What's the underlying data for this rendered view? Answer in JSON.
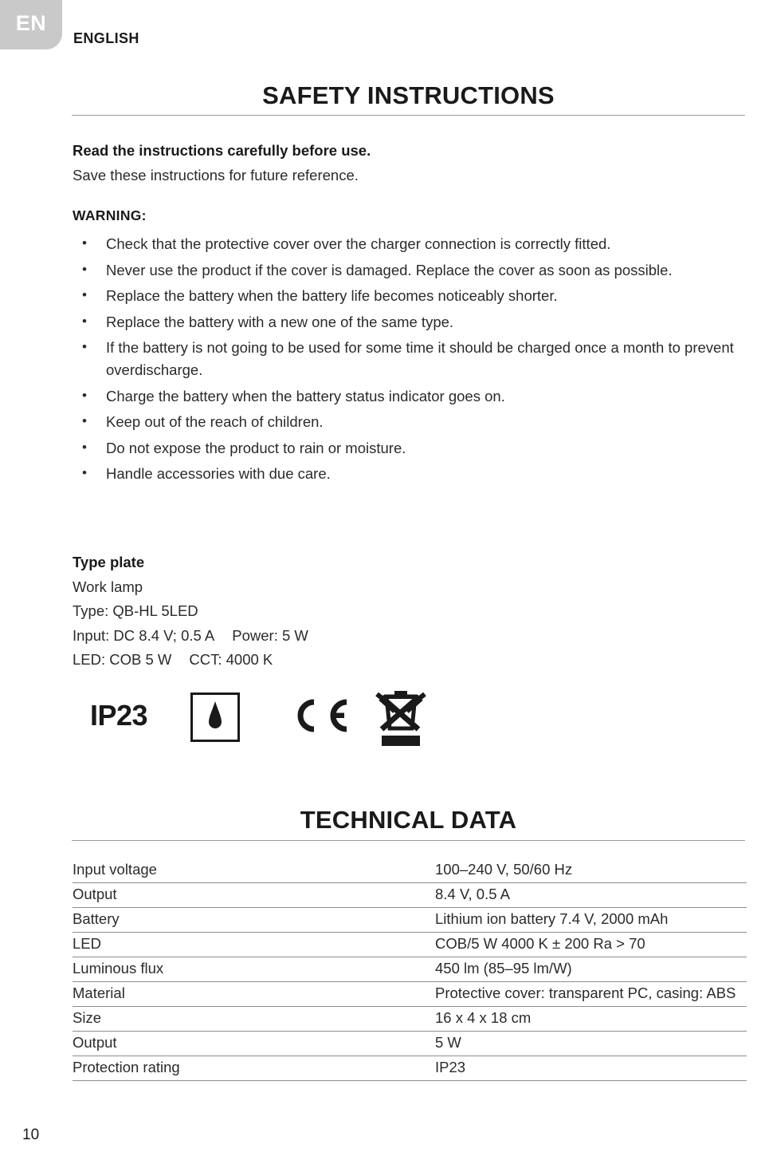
{
  "language_tab": {
    "code": "EN",
    "name": "ENGLISH"
  },
  "safety": {
    "title": "SAFETY INSTRUCTIONS",
    "lead_bold": "Read the instructions carefully before use.",
    "lead_plain": "Save these instructions for future reference.",
    "warning_heading": "WARNING:",
    "bullets": [
      "Check that the protective cover over the charger connection is correctly fitted.",
      "Never use the product if the cover is damaged. Replace the cover as soon as possible.",
      "Replace the battery when the battery life becomes noticeably shorter.",
      "Replace the battery with a new one of the same type.",
      "If the battery is not going to be used for some time it should be charged once a month to prevent overdischarge.",
      "Charge the battery when the battery status indicator goes on.",
      "Keep out of the reach of children.",
      "Do not expose the product to rain or moisture.",
      "Handle accessories with due care."
    ]
  },
  "type_plate": {
    "heading": "Type plate",
    "product": "Work lamp",
    "type_line": "Type: QB-HL 5LED",
    "input_label": "Input: DC 8.4 V; 0.5 A",
    "power_label": "Power: 5 W",
    "led_label": "LED: COB 5 W",
    "cct_label": "CCT: 4000 K"
  },
  "symbols": [
    {
      "name": "ip-rating-symbol",
      "label": "IP23"
    },
    {
      "name": "indoor-use-drop-symbol",
      "label": ""
    },
    {
      "name": "ce-mark-symbol",
      "label": "CE"
    },
    {
      "name": "weee-crossed-bin-symbol",
      "label": ""
    }
  ],
  "technical_data": {
    "title": "TECHNICAL DATA",
    "rows": [
      {
        "label": "Input voltage",
        "value": "100–240 V, 50/60 Hz"
      },
      {
        "label": "Output",
        "value": "8.4 V, 0.5 A"
      },
      {
        "label": "Battery",
        "value": "Lithium ion battery 7.4 V, 2000 mAh"
      },
      {
        "label": "LED",
        "value": "COB/5 W   4000 K ± 200  Ra > 70"
      },
      {
        "label": "Luminous flux",
        "value": "450 lm (85–95 lm/W)"
      },
      {
        "label": "Material",
        "value": "Protective cover: transparent PC, casing: ABS"
      },
      {
        "label": "Size",
        "value": "16 x 4 x 18 cm"
      },
      {
        "label": "Output",
        "value": "5 W"
      },
      {
        "label": "Protection rating",
        "value": "IP23"
      }
    ]
  },
  "page_number": "10"
}
